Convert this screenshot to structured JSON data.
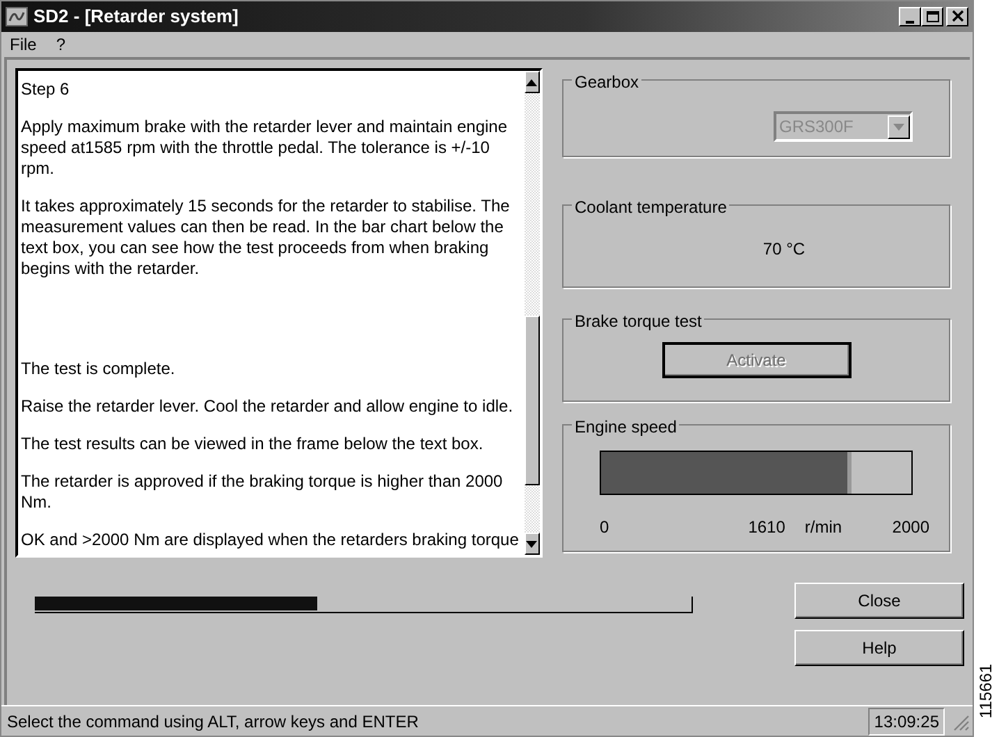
{
  "window": {
    "title": "SD2 - [Retarder system]"
  },
  "menu": [
    "File",
    "?"
  ],
  "instructions": [
    "Step 6",
    "Apply maximum brake with the retarder lever and maintain engine speed at1585 rpm with the throttle pedal. The tolerance is +/-10 rpm.",
    "It takes approximately 15 seconds for the retarder to stabilise. The measurement values can then be read. In the bar chart below the text box, you can see how the test proceeds from when braking begins with the retarder.",
    "The test is complete.",
    "Raise the retarder lever. Cool the retarder and allow engine to idle.",
    "The test results can be viewed in the frame below the text box.",
    "The retarder is approved if the braking torque is higher than 2000 Nm.",
    "OK and >2000 Nm are displayed when the retarders braking torque"
  ],
  "test_progress": {
    "level": 0.43
  },
  "gearbox": {
    "label": "Gearbox",
    "value": "GRS300F",
    "disabled": true
  },
  "coolant": {
    "label": "Coolant temperature",
    "value": "70 °C"
  },
  "brake_test": {
    "label": "Brake torque test",
    "button": "Activate",
    "disabled": true
  },
  "engine_speed": {
    "label": "Engine speed",
    "level": 0.805,
    "min": "0",
    "reading": "1610",
    "unit": "r/min",
    "max": "2000"
  },
  "buttons": [
    "Close",
    "Help"
  ],
  "status_bar": {
    "message": "Select the command using ALT, arrow keys and ENTER",
    "time": "13:09:25"
  },
  "figure_number": "115661"
}
